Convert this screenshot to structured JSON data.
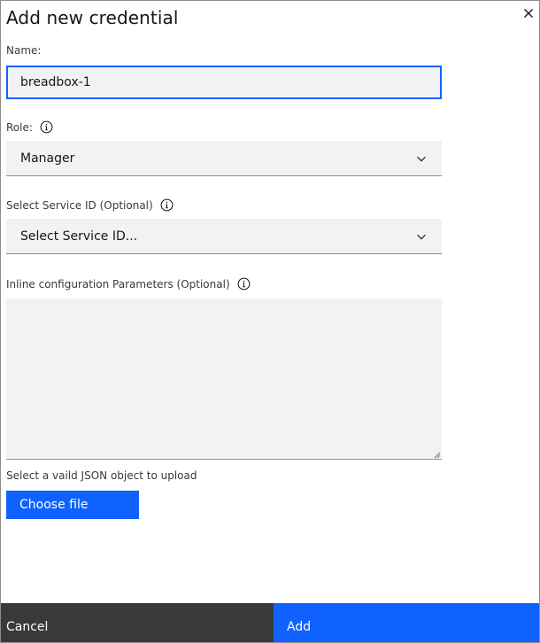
{
  "dialog": {
    "title": "Add new credential",
    "close_icon": "close-icon"
  },
  "name_field": {
    "label": "Name:",
    "value": "breadbox-1"
  },
  "role_field": {
    "label": "Role:",
    "info_icon": "info-icon",
    "selected": "Manager",
    "dropdown_icon": "chevron-down-icon"
  },
  "service_id_field": {
    "label": "Select Service ID (Optional)",
    "info_icon": "info-icon",
    "selected": "Select Service ID...",
    "dropdown_icon": "chevron-down-icon"
  },
  "inline_params_field": {
    "label": "Inline configuration Parameters (Optional)",
    "info_icon": "info-icon",
    "value": ""
  },
  "upload": {
    "helper_text": "Select a vaild JSON object to upload",
    "button_label": "Choose file"
  },
  "footer": {
    "cancel_label": "Cancel",
    "add_label": "Add"
  },
  "colors": {
    "primary": "#0f62fe",
    "secondary": "#393939",
    "field_bg": "#f2f2f2"
  }
}
